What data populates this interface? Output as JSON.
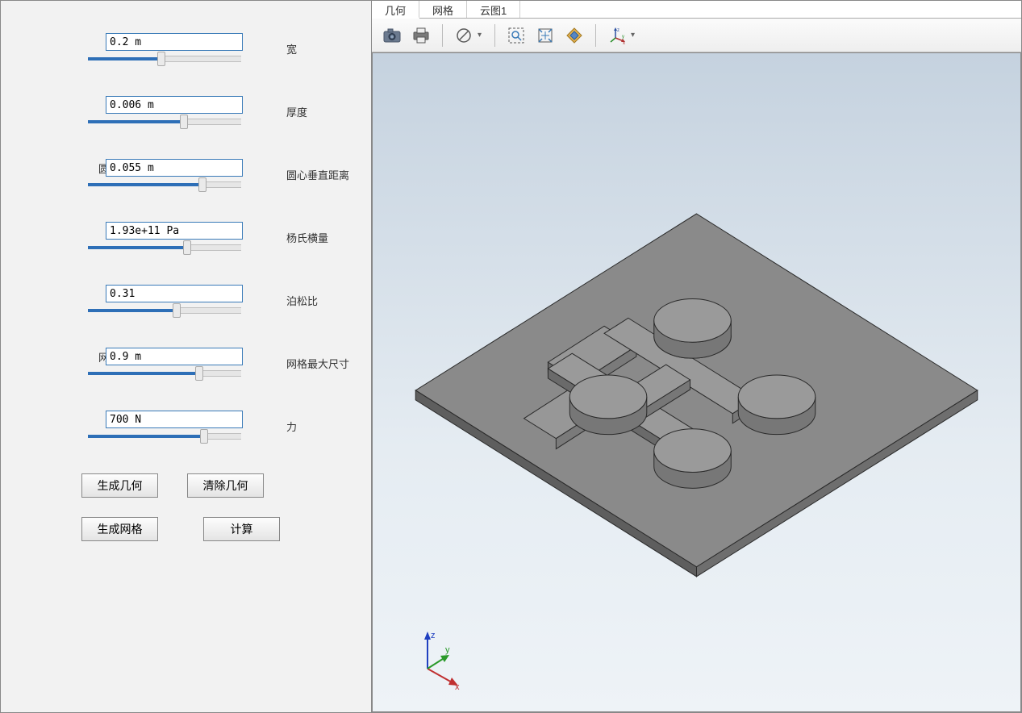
{
  "params": [
    {
      "labelLeft": "宽",
      "value": "0.2 m",
      "labelRight": "宽",
      "pos": 0.45
    },
    {
      "labelLeft": "厚度",
      "value": "0.006 m",
      "labelRight": "厚度",
      "pos": 0.6
    },
    {
      "labelLeft": "圆心垂直距离",
      "value": "0.055 m",
      "labelRight": "圆心垂直距离",
      "pos": 0.72
    },
    {
      "labelLeft": "杨氏横量",
      "value": "1.93e+11 Pa",
      "labelRight": "杨氏横量",
      "pos": 0.62
    },
    {
      "labelLeft": "泊松比",
      "value": "0.31",
      "labelRight": "泊松比",
      "pos": 0.55
    },
    {
      "labelLeft": "网格最大尺寸",
      "value": "0.9 m",
      "labelRight": "网格最大尺寸",
      "pos": 0.7
    },
    {
      "labelLeft": "力",
      "value": "700 N",
      "labelRight": "力",
      "pos": 0.73
    }
  ],
  "buttons": {
    "genGeom": "生成几何",
    "clearGeom": "清除几何",
    "genMesh": "生成网格",
    "compute": "计算"
  },
  "tabs": [
    {
      "label": "几何",
      "active": true
    },
    {
      "label": "网格",
      "active": false
    },
    {
      "label": "云图1",
      "active": false
    }
  ],
  "axes": {
    "x": "x",
    "y": "y",
    "z": "z"
  }
}
